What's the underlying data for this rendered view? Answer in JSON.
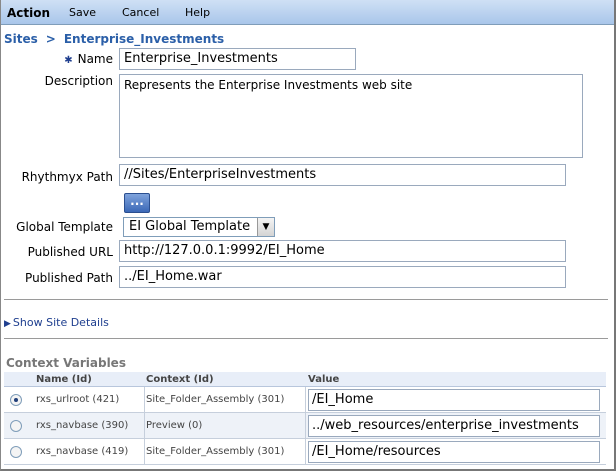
{
  "toolbar": {
    "action": "Action",
    "save": "Save",
    "cancel": "Cancel",
    "help": "Help"
  },
  "breadcrumb": {
    "root": "Sites",
    "separator": ">",
    "current": "Enterprise_Investments"
  },
  "form": {
    "name": {
      "label": "Name",
      "required_mark": "✱",
      "value": "Enterprise_Investments"
    },
    "description": {
      "label": "Description",
      "value": "Represents the Enterprise Investments web site"
    },
    "rhythmyx_path": {
      "label": "Rhythmyx Path",
      "value": "//Sites/EnterpriseInvestments",
      "browse_label": "..."
    },
    "global_template": {
      "label": "Global Template",
      "selected": "EI Global Template"
    },
    "published_url": {
      "label": "Published URL",
      "value": "http://127.0.0.1:9992/EI_Home"
    },
    "published_path": {
      "label": "Published Path",
      "value": "../EI_Home.war"
    }
  },
  "show_site_details": "Show Site Details",
  "context_variables": {
    "title": "Context Variables",
    "headers": {
      "name": "Name (Id)",
      "context": "Context (Id)",
      "value": "Value"
    },
    "rows": [
      {
        "selected": true,
        "name": "rxs_urlroot (421)",
        "context": "Site_Folder_Assembly (301)",
        "value": "/EI_Home"
      },
      {
        "selected": false,
        "name": "rxs_navbase (390)",
        "context": "Preview (0)",
        "value": "../web_resources/enterprise_investments"
      },
      {
        "selected": false,
        "name": "rxs_navbase (419)",
        "context": "Site_Folder_Assembly (301)",
        "value": "/EI_Home/resources"
      }
    ]
  }
}
